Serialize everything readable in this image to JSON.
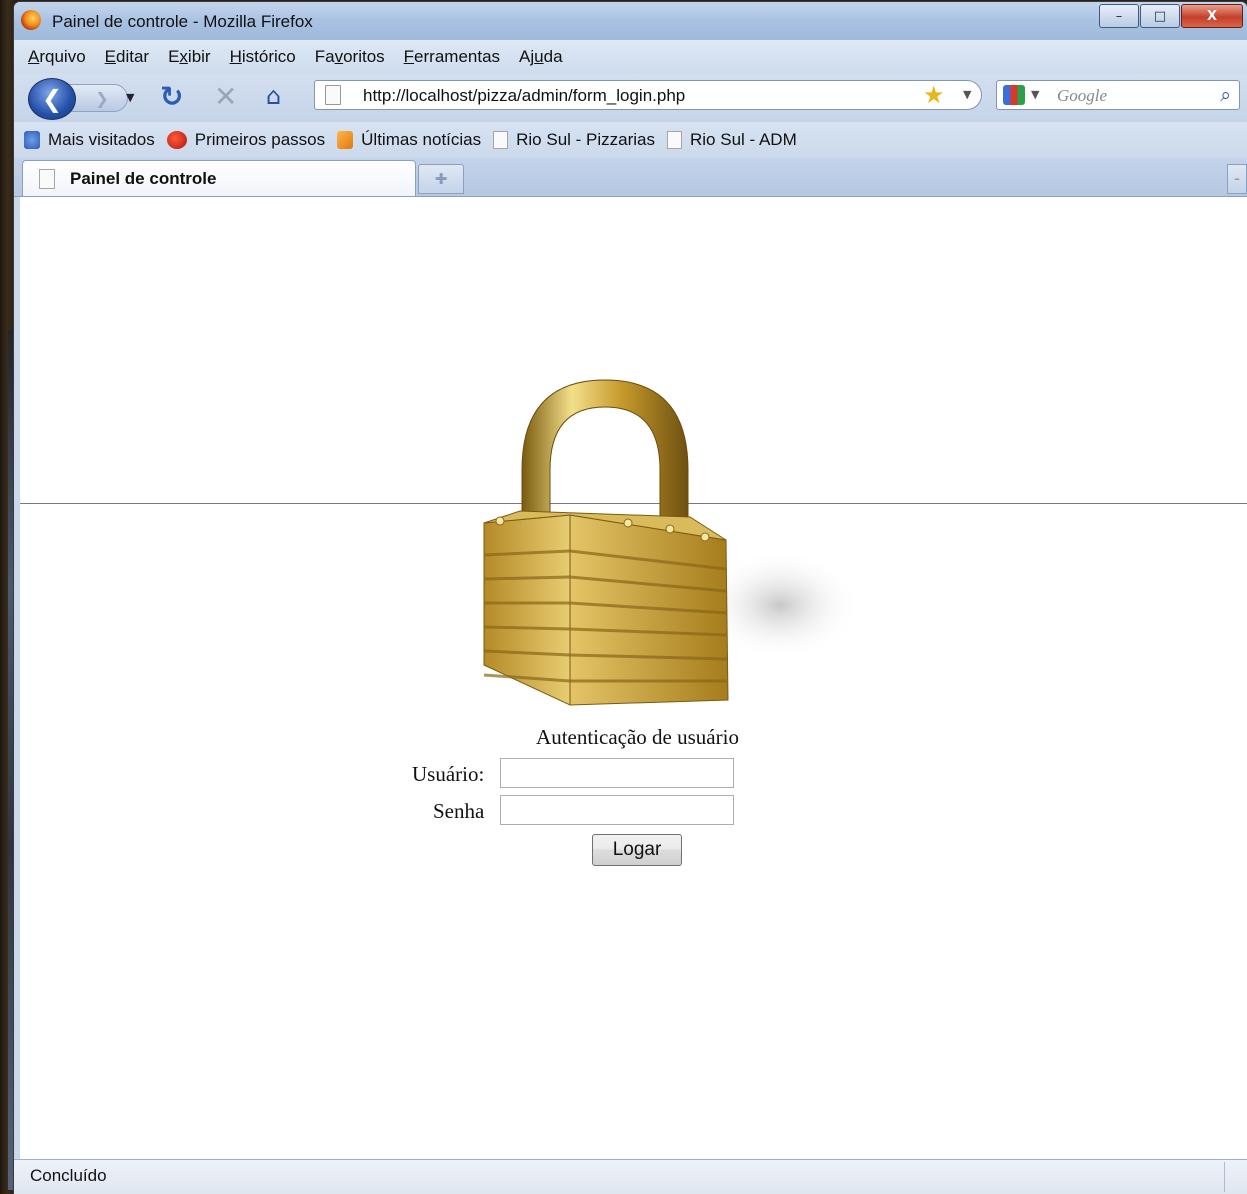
{
  "window": {
    "title": "Painel de controle - Mozilla Firefox",
    "minimize_glyph": "–",
    "maximize_glyph": "□",
    "close_glyph": "X"
  },
  "menu": [
    {
      "pre": "",
      "u": "A",
      "post": "rquivo"
    },
    {
      "pre": "",
      "u": "E",
      "post": "ditar"
    },
    {
      "pre": "E",
      "u": "x",
      "post": "ibir"
    },
    {
      "pre": "",
      "u": "H",
      "post": "istórico"
    },
    {
      "pre": "Fa",
      "u": "v",
      "post": "oritos"
    },
    {
      "pre": "",
      "u": "F",
      "post": "erramentas"
    },
    {
      "pre": "Aj",
      "u": "u",
      "post": "da"
    }
  ],
  "nav": {
    "url": "http://localhost/pizza/admin/form_login.php",
    "search_placeholder": "Google",
    "icons": [
      "back-arrow-icon",
      "forward-arrow-icon",
      "reload-icon",
      "stop-icon",
      "home-icon",
      "page-icon",
      "star-icon",
      "google-icon",
      "magnifier-icon"
    ]
  },
  "bookmarks": [
    {
      "label": "Mais visitados",
      "icon": "search-icon"
    },
    {
      "label": "Primeiros passos",
      "icon": "red-bird-icon"
    },
    {
      "label": "Últimas notícias",
      "icon": "rss-icon"
    },
    {
      "label": "Rio Sul - Pizzarias",
      "icon": "page-icon"
    },
    {
      "label": "Rio Sul - ADM",
      "icon": "page-icon"
    }
  ],
  "tabs": [
    {
      "label": "Painel de controle",
      "active": true
    }
  ],
  "page": {
    "image": "padlock-icon",
    "heading": "Autenticação de usuário",
    "user_label": "Usuário:",
    "user_value": "",
    "password_label": "Senha",
    "password_value": "",
    "submit_label": "Logar"
  },
  "status": {
    "text": "Concluído"
  }
}
